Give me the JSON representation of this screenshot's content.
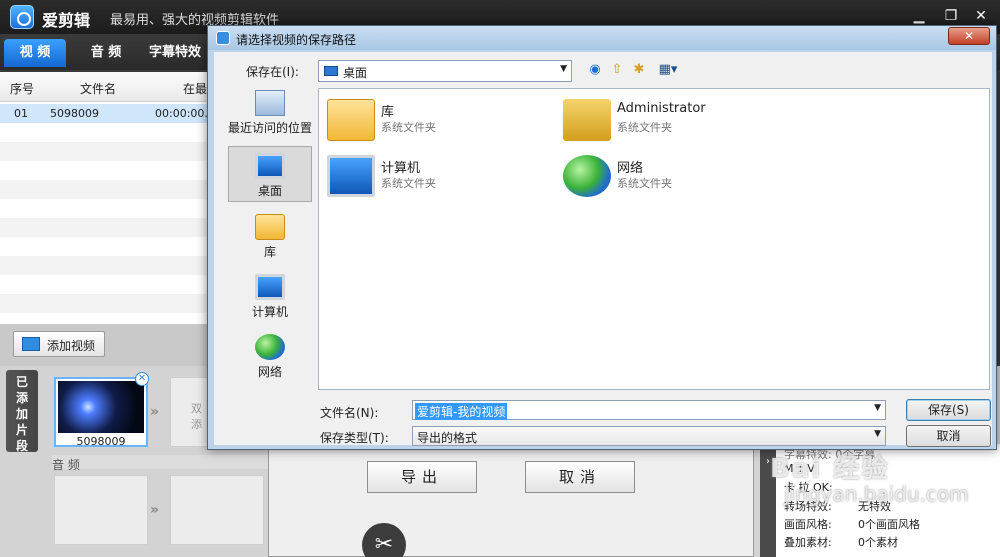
{
  "app": {
    "name": "爱剪辑",
    "slogan": "最易用、强大的视频剪辑软件",
    "tabs": [
      "视 频",
      "音 频",
      "字幕特效"
    ]
  },
  "clip_table": {
    "headers": [
      "序号",
      "文件名",
      "在最"
    ],
    "rows": [
      {
        "index": "01",
        "name": "5098009",
        "time": "00:00:00."
      }
    ]
  },
  "add_video_label": "添加视频",
  "added_clips_label": "已添加片段",
  "thumbnail": {
    "caption": "5098009",
    "next_hint": "双\n添"
  },
  "audio_label": "音 频",
  "export_panel": {
    "export_label": "导出",
    "cancel_label": "取消"
  },
  "info_panel": {
    "rows": [
      {
        "label": "M  T  V:",
        "value": ""
      },
      {
        "label": "卡 拉 OK:",
        "value": ""
      },
      {
        "label": "转场特效:",
        "value": "无特效"
      },
      {
        "label": "画面风格:",
        "value": "0个画面风格"
      },
      {
        "label": "叠加素材:",
        "value": "0个素材"
      }
    ],
    "top_row": "字幕特效:      0个字幕"
  },
  "watermark": {
    "brand": "Bai 经验",
    "url": "jingyan.baidu.com"
  },
  "dialog": {
    "title": "请选择视频的保存路径",
    "close_label": "✕",
    "save_in_label": "保存在(I):",
    "save_in_value": "桌面",
    "places": [
      {
        "label": "最近访问的位置",
        "icon": "recent-icon"
      },
      {
        "label": "桌面",
        "icon": "desktop-icon"
      },
      {
        "label": "库",
        "icon": "library-icon"
      },
      {
        "label": "计算机",
        "icon": "computer-icon"
      },
      {
        "label": "网络",
        "icon": "network-icon"
      }
    ],
    "items": [
      {
        "name": "库",
        "type": "系统文件夹",
        "icon": "library-folder-icon"
      },
      {
        "name": "Administrator",
        "type": "系统文件夹",
        "icon": "user-folder-icon"
      },
      {
        "name": "计算机",
        "type": "系统文件夹",
        "icon": "computer-icon"
      },
      {
        "name": "网络",
        "type": "系统文件夹",
        "icon": "network-icon"
      }
    ],
    "filename_label": "文件名(N):",
    "filename_value": "爱剪辑-我的视频",
    "filetype_label": "保存类型(T):",
    "filetype_value": "导出的格式",
    "save_label": "保存(S)",
    "cancel_label": "取消"
  }
}
